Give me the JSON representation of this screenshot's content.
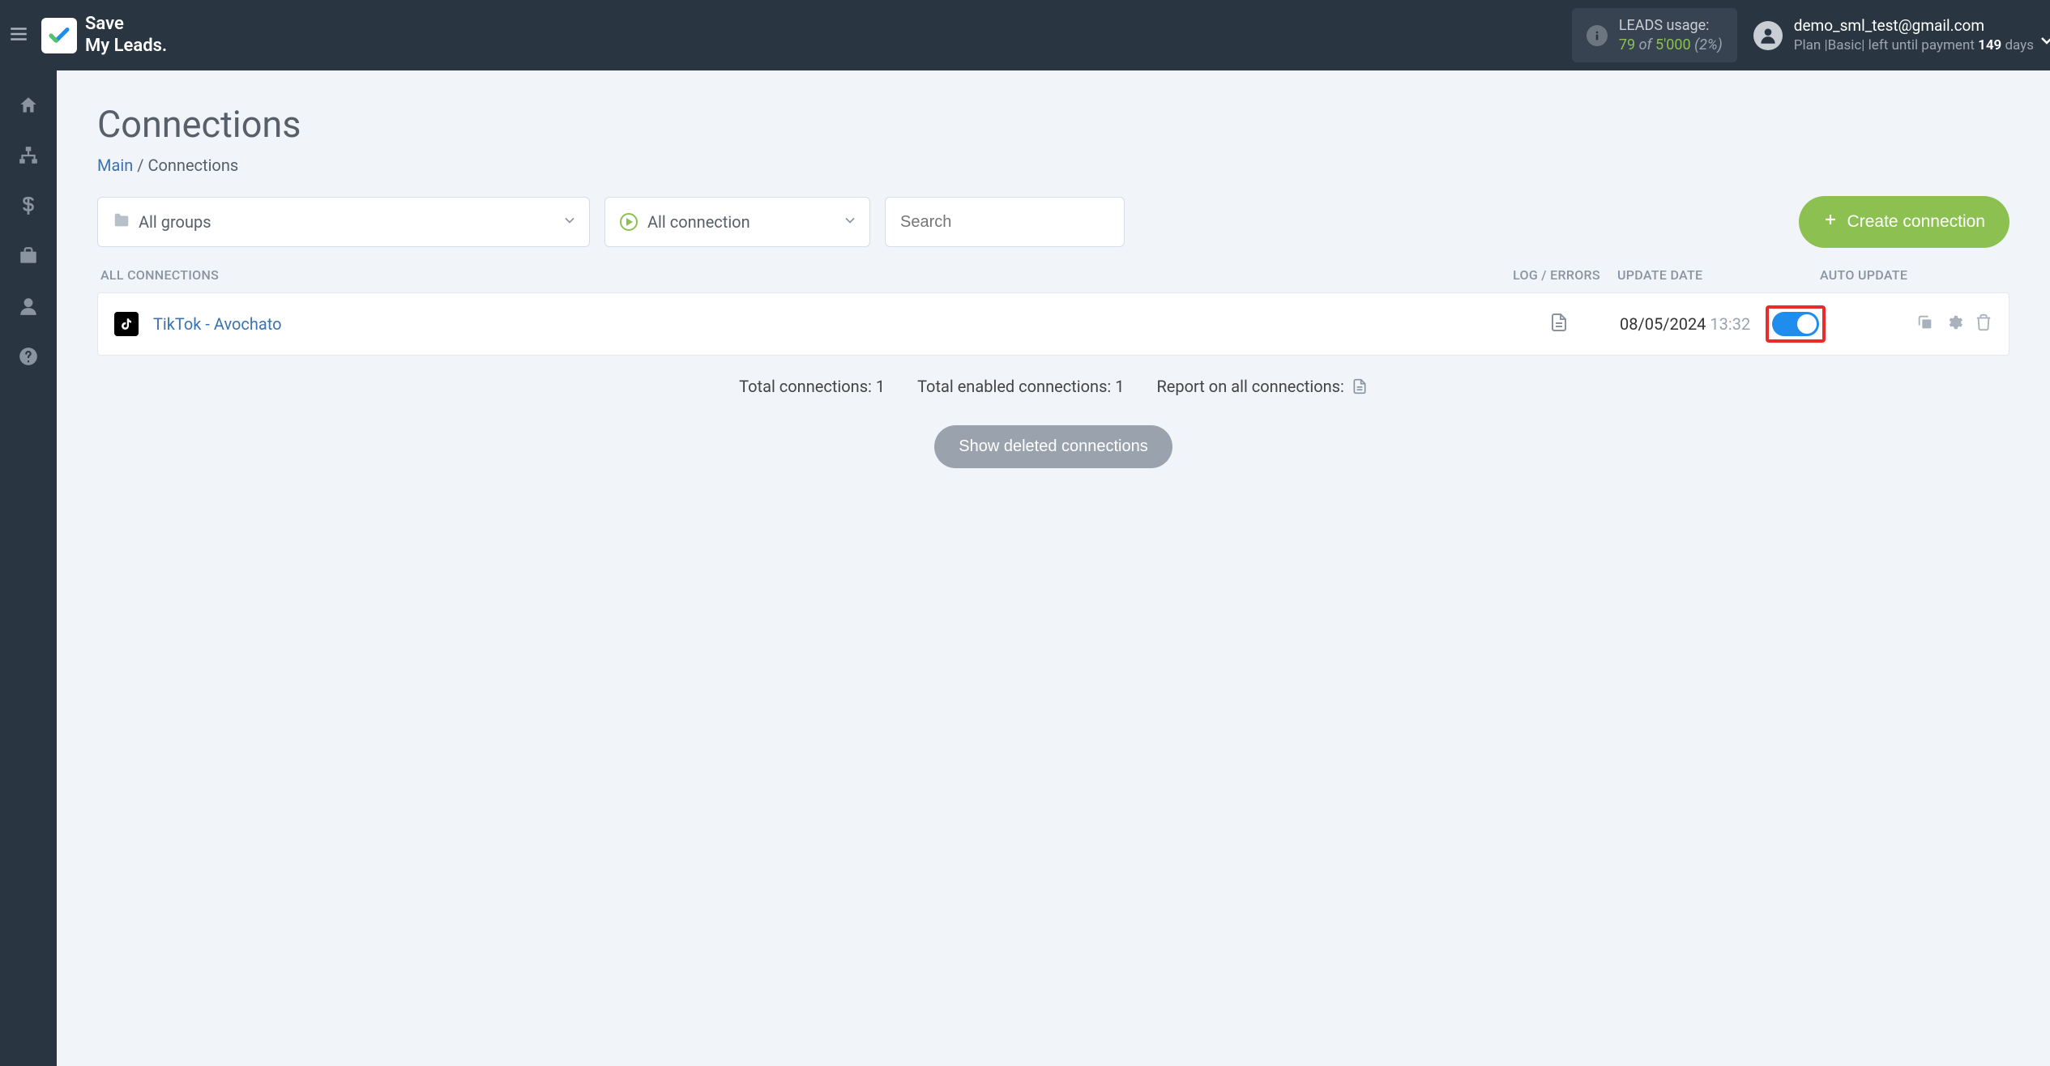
{
  "topbar": {
    "logo_line1": "Save",
    "logo_line2": "My Leads.",
    "leads_usage_label": "LEADS usage:",
    "leads_used": "79",
    "leads_of": "of",
    "leads_limit": "5'000",
    "leads_pct": "(2%)",
    "user_email": "demo_sml_test@gmail.com",
    "plan_prefix": "Plan |",
    "plan_name": "Basic",
    "plan_mid": "| left until payment ",
    "plan_days": "149",
    "plan_days_suffix": " days"
  },
  "page": {
    "title": "Connections",
    "breadcrumb_main": "Main",
    "breadcrumb_sep": " / ",
    "breadcrumb_current": "Connections"
  },
  "filters": {
    "groups_label": "All groups",
    "status_label": "All connection",
    "search_placeholder": "Search",
    "create_label": "Create connection"
  },
  "table": {
    "header_name": "ALL CONNECTIONS",
    "header_log": "LOG / ERRORS",
    "header_date": "UPDATE DATE",
    "header_auto": "AUTO UPDATE",
    "rows": [
      {
        "name": "TikTok - Avochato",
        "date": "08/05/2024",
        "time": "13:32",
        "auto_on": true
      }
    ]
  },
  "summary": {
    "total_label": "Total connections: ",
    "total_value": "1",
    "enabled_label": "Total enabled connections: ",
    "enabled_value": "1",
    "report_label": "Report on all connections:"
  },
  "show_deleted_label": "Show deleted connections"
}
